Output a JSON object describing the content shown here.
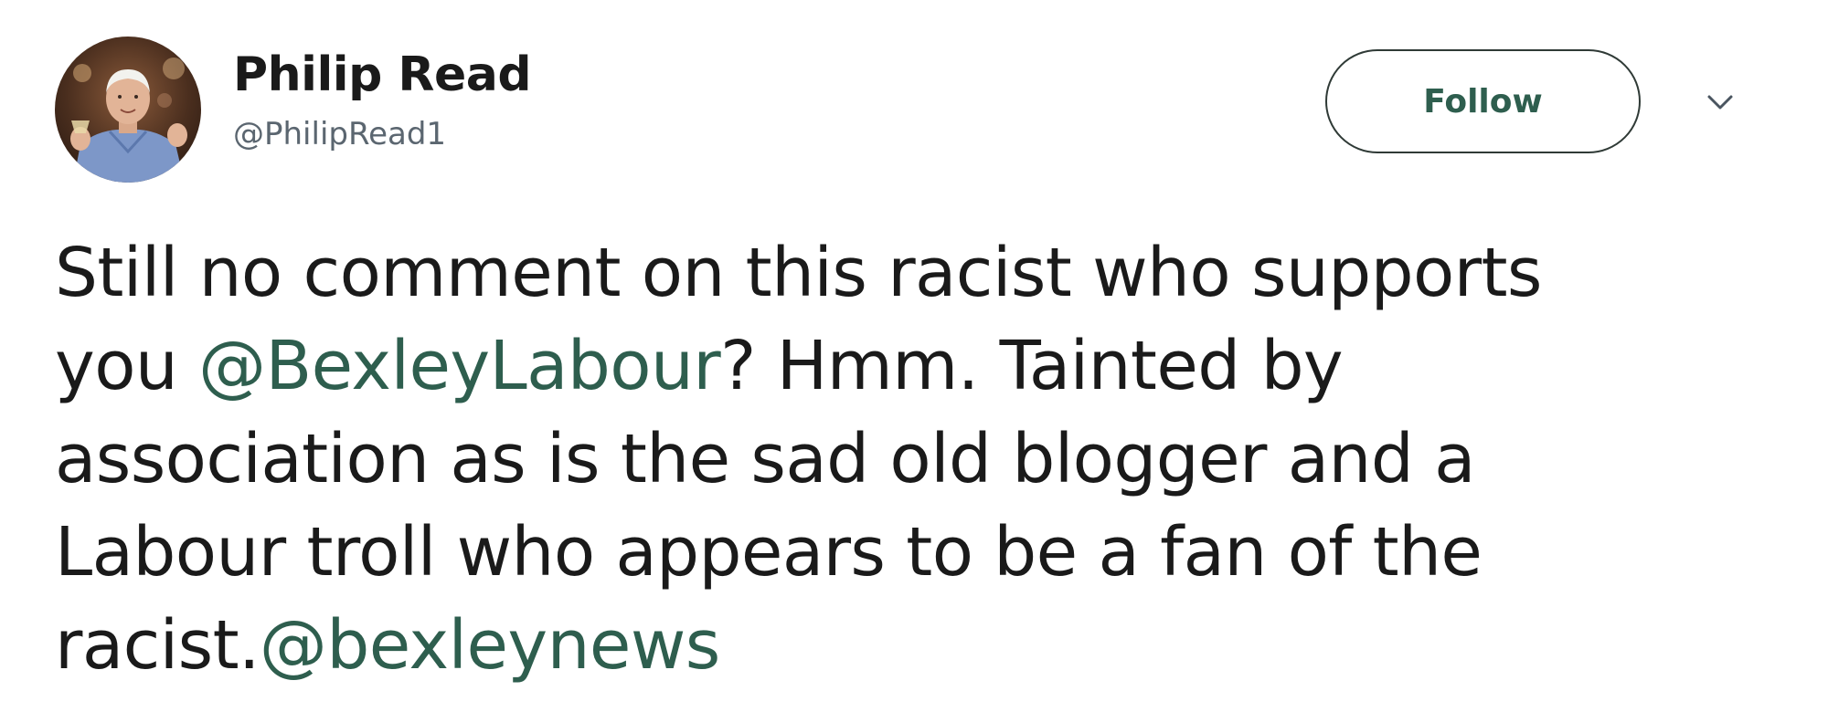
{
  "tweet": {
    "author": {
      "display_name": "Philip Read",
      "handle": "@PhilipRead1"
    },
    "follow_label": "Follow",
    "text_lines": [
      [
        {
          "text": "Still no comment on this racist who supports",
          "type": "text"
        }
      ],
      [
        {
          "text": "you ",
          "type": "text"
        },
        {
          "text": "@BexleyLabour",
          "type": "mention"
        },
        {
          "text": "? Hmm. Tainted by",
          "type": "text"
        }
      ],
      [
        {
          "text": "association as is the sad old blogger and a",
          "type": "text"
        }
      ],
      [
        {
          "text": "Labour troll who appears to be a fan of the",
          "type": "text"
        }
      ],
      [
        {
          "text": "racist.",
          "type": "text"
        },
        {
          "text": "@bexleynews",
          "type": "mention"
        }
      ]
    ],
    "icons": {
      "avatar": "avatar-photo",
      "menu": "chevron-down-icon"
    },
    "colors": {
      "mention": "#2e5e4e",
      "text": "#1a1a1a",
      "handle": "#5b6670",
      "button_border": "#2f3a36"
    }
  }
}
